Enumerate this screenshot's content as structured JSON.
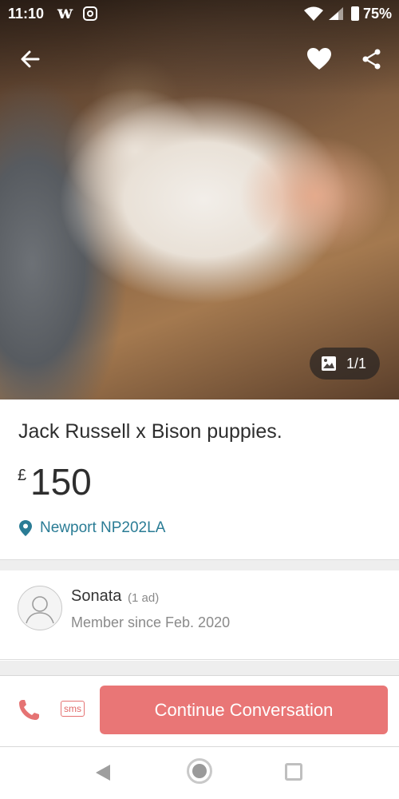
{
  "status_bar": {
    "time": "11:10",
    "app_glyph": "w",
    "battery": "75%",
    "icons": [
      "w-app-icon",
      "instagram-icon",
      "wifi-icon",
      "signal-icon",
      "battery-icon"
    ]
  },
  "hero": {
    "image_alt": "puppy-photo",
    "counter": "1/1"
  },
  "listing": {
    "title": "Jack Russell x Bison puppies.",
    "currency": "£",
    "price": "150",
    "location": "Newport NP202LA"
  },
  "seller": {
    "name": "Sonata",
    "ads": "(1 ad)",
    "member_since": "Member since Feb. 2020"
  },
  "actions": {
    "sms_label": "sms",
    "cta_label": "Continue Conversation"
  },
  "colors": {
    "accent": "#e97676",
    "link": "#2a7c95"
  }
}
